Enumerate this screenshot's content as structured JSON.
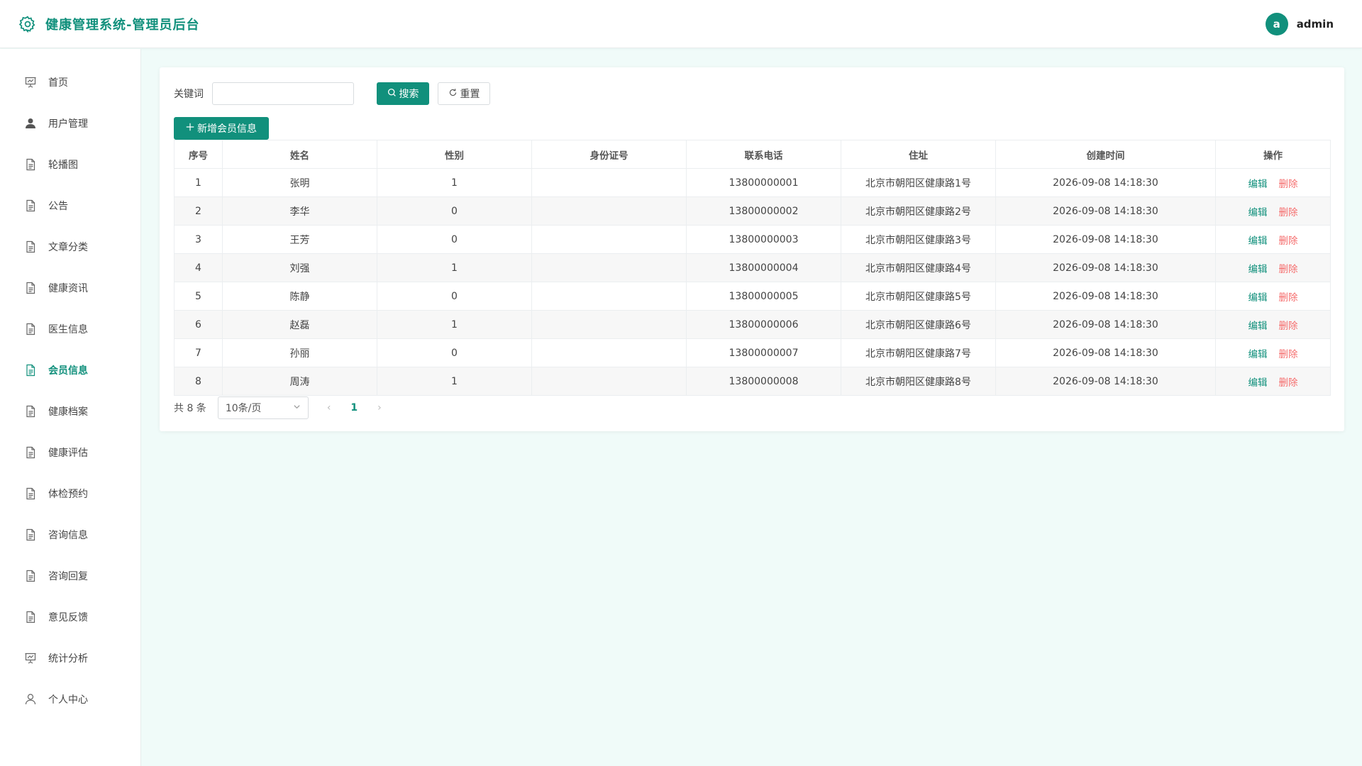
{
  "app": {
    "title": "健康管理系统-管理员后台",
    "brand_color": "#11907c"
  },
  "user": {
    "avatar_letter": "a",
    "name": "admin"
  },
  "sidebar": {
    "items": [
      {
        "label": "首页",
        "icon": "presentation-icon",
        "active": false
      },
      {
        "label": "用户管理",
        "icon": "user-filled-icon",
        "active": false
      },
      {
        "label": "轮播图",
        "icon": "document-icon",
        "active": false
      },
      {
        "label": "公告",
        "icon": "document-icon",
        "active": false
      },
      {
        "label": "文章分类",
        "icon": "document-icon",
        "active": false
      },
      {
        "label": "健康资讯",
        "icon": "document-icon",
        "active": false
      },
      {
        "label": "医生信息",
        "icon": "document-icon",
        "active": false
      },
      {
        "label": "会员信息",
        "icon": "document-icon",
        "active": true
      },
      {
        "label": "健康档案",
        "icon": "document-icon",
        "active": false
      },
      {
        "label": "健康评估",
        "icon": "document-icon",
        "active": false
      },
      {
        "label": "体检预约",
        "icon": "document-icon",
        "active": false
      },
      {
        "label": "咨询信息",
        "icon": "document-icon",
        "active": false
      },
      {
        "label": "咨询回复",
        "icon": "document-icon",
        "active": false
      },
      {
        "label": "意见反馈",
        "icon": "document-icon",
        "active": false
      },
      {
        "label": "统计分析",
        "icon": "presentation-icon",
        "active": false
      },
      {
        "label": "个人中心",
        "icon": "user-outline-icon",
        "active": false
      }
    ]
  },
  "search": {
    "label": "关键词",
    "value": "",
    "search_button": "搜索",
    "reset_button": "重置"
  },
  "toolbar": {
    "add_button": "新增会员信息"
  },
  "table": {
    "columns": [
      "序号",
      "姓名",
      "性别",
      "身份证号",
      "联系电话",
      "住址",
      "创建时间",
      "操作"
    ],
    "edit_label": "编辑",
    "delete_label": "删除",
    "rows": [
      [
        "1",
        "张明",
        "1",
        "",
        "13800000001",
        "北京市朝阳区健康路1号",
        "2026-09-08 14:18:30"
      ],
      [
        "2",
        "李华",
        "0",
        "",
        "13800000002",
        "北京市朝阳区健康路2号",
        "2026-09-08 14:18:30"
      ],
      [
        "3",
        "王芳",
        "0",
        "",
        "13800000003",
        "北京市朝阳区健康路3号",
        "2026-09-08 14:18:30"
      ],
      [
        "4",
        "刘强",
        "1",
        "",
        "13800000004",
        "北京市朝阳区健康路4号",
        "2026-09-08 14:18:30"
      ],
      [
        "5",
        "陈静",
        "0",
        "",
        "13800000005",
        "北京市朝阳区健康路5号",
        "2026-09-08 14:18:30"
      ],
      [
        "6",
        "赵磊",
        "1",
        "",
        "13800000006",
        "北京市朝阳区健康路6号",
        "2026-09-08 14:18:30"
      ],
      [
        "7",
        "孙丽",
        "0",
        "",
        "13800000007",
        "北京市朝阳区健康路7号",
        "2026-09-08 14:18:30"
      ],
      [
        "8",
        "周涛",
        "1",
        "",
        "13800000008",
        "北京市朝阳区健康路8号",
        "2026-09-08 14:18:30"
      ]
    ]
  },
  "pagination": {
    "total_text": "共 8 条",
    "page_size": "10条/页",
    "current_page": "1"
  }
}
